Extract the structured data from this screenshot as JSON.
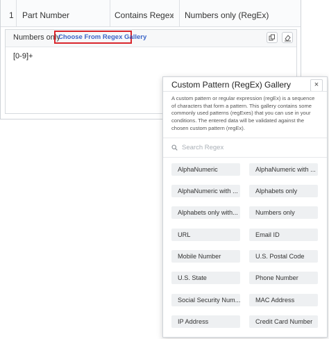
{
  "rule": {
    "index": "1",
    "field": "Part Number",
    "operator": "Contains Regex",
    "criteria": "Numbers only (RegEx)"
  },
  "value_box": {
    "label": "Numbers only",
    "gallery_link": "Choose From Regex Gallery",
    "regex_value": "[0-9]+",
    "icons": [
      "copy-icon",
      "eraser-icon"
    ]
  },
  "gallery": {
    "title": "Custom Pattern (RegEx) Gallery",
    "close": "×",
    "description": "A custom pattern or regular expression (regEx) is a sequence of characters that form a pattern. This gallery contains some commonly used patterns (regExes) that you can use in your conditions. The entered data will be validated against the chosen custom pattern (regEx).",
    "search_placeholder": "Search Regex",
    "patterns": [
      "AlphaNumeric",
      "AlphaNumeric with ...",
      "AlphaNumeric with ...",
      "Alphabets only",
      "Alphabets only with...",
      "Numbers only",
      "URL",
      "Email ID",
      "Mobile Number",
      "U.S. Postal Code",
      "U.S. State",
      "Phone Number",
      "Social Security Num...",
      "MAC Address",
      "IP Address",
      "Credit Card Number"
    ]
  }
}
